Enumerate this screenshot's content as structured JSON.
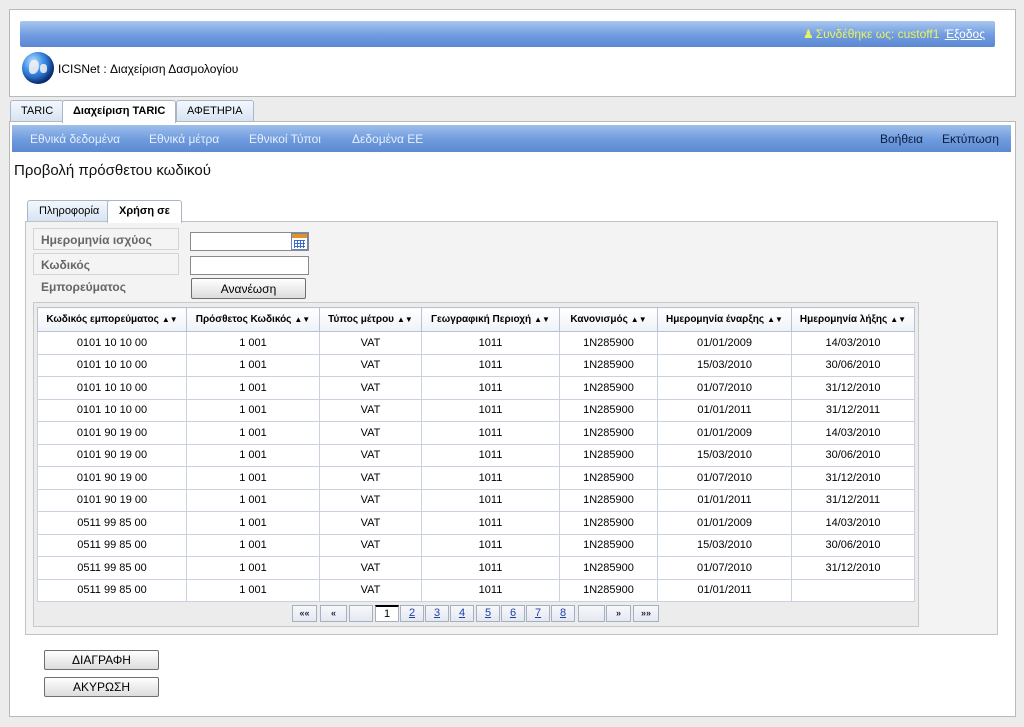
{
  "header": {
    "logged_in_label": "Συνδέθηκε ως: custoff1",
    "logout": "Έξοδος",
    "app_title": "ICISNet : Διαχείριση Δασμολογίου"
  },
  "main_tabs": [
    {
      "label": "TARIC"
    },
    {
      "label": "Διαχείριση TARIC"
    },
    {
      "label": "ΑΦΕΤΗΡΙΑ"
    }
  ],
  "menu": {
    "left": [
      "Εθνικά δεδομένα",
      "Εθνικά μέτρα",
      "Εθνικοί Τύποι",
      "Δεδομένα ΕΕ"
    ],
    "right": [
      "Βοήθεια",
      "Εκτύπωση"
    ]
  },
  "page_title": "Προβολή πρόσθετου κωδικού",
  "inner_tabs": [
    {
      "label": "Πληροφορία"
    },
    {
      "label": "Χρήση σε"
    }
  ],
  "form": {
    "date_label": "Ημερομηνία ισχύος",
    "date_value": "",
    "code_label": "Κωδικός Εμπορεύματος",
    "code_value": "",
    "refresh": "Ανανέωση"
  },
  "table": {
    "columns": [
      "Κωδικός εμπορεύματος",
      "Πρόσθετος Κωδικός",
      "Τύπος μέτρου",
      "Γεωγραφική Περιοχή",
      "Κανονισμός",
      "Ημερομηνία έναρξης",
      "Ημερομηνία λήξης"
    ],
    "sort_icon": "sort-arrows-icon",
    "rows": [
      [
        "0101 10 10 00",
        "1 001",
        "VAT",
        "1011",
        "1N285900",
        "01/01/2009",
        "14/03/2010"
      ],
      [
        "0101 10 10 00",
        "1 001",
        "VAT",
        "1011",
        "1N285900",
        "15/03/2010",
        "30/06/2010"
      ],
      [
        "0101 10 10 00",
        "1 001",
        "VAT",
        "1011",
        "1N285900",
        "01/07/2010",
        "31/12/2010"
      ],
      [
        "0101 10 10 00",
        "1 001",
        "VAT",
        "1011",
        "1N285900",
        "01/01/2011",
        "31/12/2011"
      ],
      [
        "0101 90 19 00",
        "1 001",
        "VAT",
        "1011",
        "1N285900",
        "01/01/2009",
        "14/03/2010"
      ],
      [
        "0101 90 19 00",
        "1 001",
        "VAT",
        "1011",
        "1N285900",
        "15/03/2010",
        "30/06/2010"
      ],
      [
        "0101 90 19 00",
        "1 001",
        "VAT",
        "1011",
        "1N285900",
        "01/07/2010",
        "31/12/2010"
      ],
      [
        "0101 90 19 00",
        "1 001",
        "VAT",
        "1011",
        "1N285900",
        "01/01/2011",
        "31/12/2011"
      ],
      [
        "0511 99 85 00",
        "1 001",
        "VAT",
        "1011",
        "1N285900",
        "01/01/2009",
        "14/03/2010"
      ],
      [
        "0511 99 85 00",
        "1 001",
        "VAT",
        "1011",
        "1N285900",
        "15/03/2010",
        "30/06/2010"
      ],
      [
        "0511 99 85 00",
        "1 001",
        "VAT",
        "1011",
        "1N285900",
        "01/07/2010",
        "31/12/2010"
      ],
      [
        "0511 99 85 00",
        "1 001",
        "VAT",
        "1011",
        "1N285900",
        "01/01/2011",
        ""
      ]
    ]
  },
  "pagination": {
    "first": "««",
    "prev": "«",
    "next": "»",
    "last": "»»",
    "pages": [
      "1",
      "2",
      "3",
      "4",
      "5",
      "6",
      "7",
      "8"
    ],
    "current": "1"
  },
  "actions": {
    "delete": "ΔΙΑΓΡΑΦΗ",
    "cancel": "ΑΚΥΡΩΣΗ"
  }
}
